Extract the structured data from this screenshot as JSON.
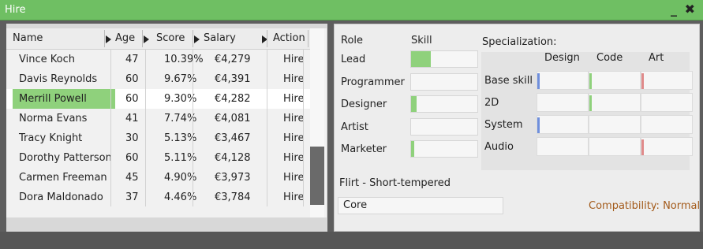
{
  "window": {
    "title": "Hire",
    "controls": "_ ✖"
  },
  "table": {
    "headers": {
      "name": "Name",
      "age": "Age",
      "score": "Score",
      "salary": "Salary",
      "action": "Action"
    },
    "rows": [
      {
        "name": "Vince Koch",
        "age": "47",
        "score": "10.39%",
        "salary": "€4,279",
        "action": "Hire"
      },
      {
        "name": "Davis Reynolds",
        "age": "60",
        "score": "9.67%",
        "salary": "€4,391",
        "action": "Hire"
      },
      {
        "name": "Merrill Powell",
        "age": "60",
        "score": "9.30%",
        "salary": "€4,282",
        "action": "Hire"
      },
      {
        "name": "Norma Evans",
        "age": "41",
        "score": "7.74%",
        "salary": "€4,081",
        "action": "Hire"
      },
      {
        "name": "Tracy Knight",
        "age": "30",
        "score": "5.13%",
        "salary": "€3,467",
        "action": "Hire"
      },
      {
        "name": "Dorothy Patterson",
        "age": "60",
        "score": "5.11%",
        "salary": "€4,128",
        "action": "Hire"
      },
      {
        "name": "Carmen Freeman",
        "age": "45",
        "score": "4.90%",
        "salary": "€3,973",
        "action": "Hire"
      },
      {
        "name": "Dora Maldonado",
        "age": "37",
        "score": "4.46%",
        "salary": "€3,784",
        "action": "Hire"
      }
    ],
    "selected_index": 2
  },
  "details": {
    "role_header": "Role",
    "skill_header": "Skill",
    "roles": [
      {
        "label": "Lead",
        "skill_fraction": 0.3
      },
      {
        "label": "Programmer",
        "skill_fraction": 0.0
      },
      {
        "label": "Designer",
        "skill_fraction": 0.08
      },
      {
        "label": "Artist",
        "skill_fraction": 0.0
      },
      {
        "label": "Marketer",
        "skill_fraction": 0.05
      }
    ],
    "specialization": {
      "title": "Specialization:",
      "columns": [
        "Design",
        "Code",
        "Art"
      ],
      "rows": [
        "Base skill",
        "2D",
        "System",
        "Audio"
      ],
      "markers": [
        [
          "blue",
          "green",
          "red"
        ],
        [
          "",
          "green",
          ""
        ],
        [
          "blue",
          "",
          ""
        ],
        [
          "",
          "",
          "red"
        ]
      ]
    },
    "traits": "Flirt - Short-tempered",
    "core": "Core",
    "compatibility": "Compatibility: Normal"
  },
  "colors": {
    "titlebar": "#6fbf63",
    "selected": "#8fd17c",
    "skill_fill": "#8fd17c",
    "marker_blue": "#6f8fdc",
    "marker_green": "#8fd17c",
    "marker_red": "#e08a8a",
    "compat_text": "#a35a1a"
  }
}
